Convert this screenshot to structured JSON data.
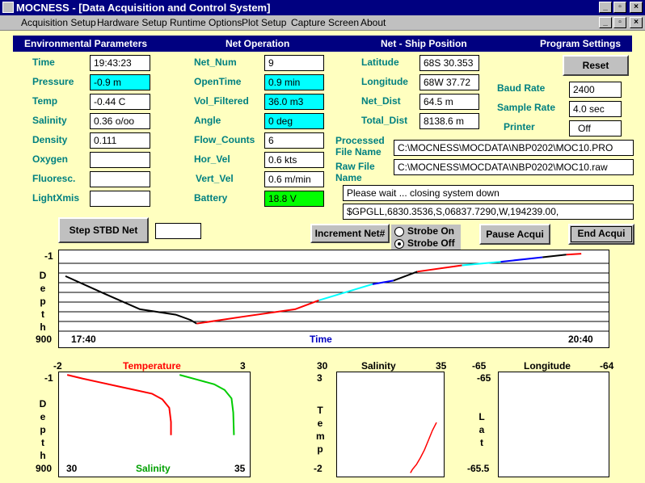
{
  "window": {
    "title": "MOCNESS - [Data Acquisition and Control System]"
  },
  "menu": [
    "Acquisition Setup",
    "Hardware Setup",
    "Runtime Options",
    "Plot Setup",
    "Capture Screen",
    "About"
  ],
  "headers": {
    "env": "Environmental Parameters",
    "net": "Net Operation",
    "pos": "Net - Ship Position",
    "prog": "Program Settings"
  },
  "env": {
    "time_label": "Time",
    "time": "19:43:23",
    "pressure_label": "Pressure",
    "pressure": "-0.9 m",
    "temp_label": "Temp",
    "temp": "-0.44 C",
    "salinity_label": "Salinity",
    "salinity": "0.36 o/oo",
    "density_label": "Density",
    "density": "0.111",
    "oxygen_label": "Oxygen",
    "oxygen": "",
    "fluoresc_label": "Fluoresc.",
    "fluoresc": "",
    "lightx_label": "LightXmis",
    "lightx": ""
  },
  "net": {
    "num_label": "Net_Num",
    "num": "9",
    "opentime_label": "OpenTime",
    "opentime": "0.9 min",
    "vol_label": "Vol_Filtered",
    "vol": "36.0 m3",
    "angle_label": "Angle",
    "angle": "0 deg",
    "flow_label": "Flow_Counts",
    "flow": "6",
    "horvel_label": "Hor_Vel",
    "horvel": "0.6 kts",
    "vertvel_label": "Vert_Vel",
    "vertvel": "0.6 m/min",
    "battery_label": "Battery",
    "battery": "18.8 V"
  },
  "pos": {
    "lat_label": "Latitude",
    "lat": "68S 30.353",
    "lon_label": "Longitude",
    "lon": "68W 37.72",
    "netdist_label": "Net_Dist",
    "netdist": "64.5 m",
    "totaldist_label": "Total_Dist",
    "totaldist": "8138.6 m"
  },
  "prog": {
    "reset": "Reset",
    "baud_label": "Baud Rate",
    "baud": "2400",
    "sample_label": "Sample Rate",
    "sample": "4.0 sec",
    "printer_label": "Printer",
    "printer": "Off"
  },
  "files": {
    "processed_label_1": "Processed",
    "processed_label_2": "File Name",
    "processed": "C:\\MOCNESS\\MOCDATA\\NBP0202\\MOC10.PRO",
    "raw_label_1": "Raw File",
    "raw_label_2": "Name",
    "raw": "C:\\MOCNESS\\MOCDATA\\NBP0202\\MOC10.raw",
    "status": "Please wait ... closing system down",
    "gps": "$GPGLL,6830.3536,S,06837.7290,W,194239.00,"
  },
  "buttons": {
    "step": "Step STBD Net",
    "step_value": "",
    "increment": "Increment Net#",
    "pause": "Pause Acqui",
    "end": "End Acqui"
  },
  "strobe": {
    "on": "Strobe On",
    "off": "Strobe Off",
    "selected": "off"
  },
  "colors": {
    "navy": "#000080",
    "label": "#008080",
    "bg": "#ffffc0"
  },
  "chart_data": [
    {
      "type": "line",
      "title": "",
      "xlabel": "Time",
      "ylabel": "Depth",
      "x_ticks": [
        "17:40",
        "20:40"
      ],
      "y_ticks": [
        "-1",
        "900"
      ],
      "xlim": [
        "17:40",
        "20:40"
      ],
      "ylim": [
        -1,
        900
      ],
      "grid": true,
      "series": [
        {
          "color": "#000000",
          "x": [
            "17:40",
            "17:52",
            "18:05",
            "18:17",
            "18:22",
            "18:24"
          ],
          "y": [
            250,
            430,
            620,
            680,
            740,
            780
          ]
        },
        {
          "color": "#ff0000",
          "x": [
            "18:24",
            "18:40",
            "18:57",
            "19:05"
          ],
          "y": [
            780,
            700,
            620,
            520
          ]
        },
        {
          "color": "#00ffff",
          "x": [
            "19:05",
            "19:15",
            "19:23"
          ],
          "y": [
            520,
            420,
            340
          ]
        },
        {
          "color": "#0000ff",
          "x": [
            "19:23",
            "19:30"
          ],
          "y": [
            340,
            300
          ]
        },
        {
          "color": "#000000",
          "x": [
            "19:30",
            "19:38"
          ],
          "y": [
            300,
            200
          ]
        },
        {
          "color": "#ff0000",
          "x": [
            "19:38",
            "19:53"
          ],
          "y": [
            200,
            130
          ]
        },
        {
          "color": "#00ffff",
          "x": [
            "19:53",
            "20:06"
          ],
          "y": [
            130,
            90
          ]
        },
        {
          "color": "#0000ff",
          "x": [
            "20:06",
            "20:20"
          ],
          "y": [
            90,
            40
          ]
        },
        {
          "color": "#000000",
          "x": [
            "20:20",
            "20:28"
          ],
          "y": [
            40,
            10
          ]
        },
        {
          "color": "#ff0000",
          "x": [
            "20:28",
            "20:33"
          ],
          "y": [
            10,
            0
          ]
        }
      ]
    },
    {
      "type": "line",
      "title": "",
      "ylabel": "Depth",
      "xlabel_top": "Temperature",
      "xlabel_bottom": "Salinity",
      "temp_ticks": [
        "-2",
        "3"
      ],
      "sal_ticks": [
        "30",
        "35"
      ],
      "y_ticks": [
        "-1",
        "900"
      ],
      "temp_lim": [
        -2,
        3
      ],
      "sal_lim": [
        30,
        35
      ],
      "ylim": [
        -1,
        900
      ],
      "series": [
        {
          "name": "Temperature",
          "color": "#ff0000",
          "x": [
            -1.95,
            -1.5,
            -1.0,
            -0.5,
            0.0,
            0.5,
            0.8,
            1.0,
            1.05,
            1.05
          ],
          "y": [
            0,
            40,
            80,
            120,
            160,
            200,
            260,
            350,
            500,
            640
          ]
        },
        {
          "name": "Salinity",
          "color": "#00cc00",
          "x": [
            33.3,
            33.8,
            34.3,
            34.6,
            34.8,
            34.85,
            34.87
          ],
          "y": [
            0,
            50,
            100,
            160,
            250,
            400,
            640
          ]
        }
      ]
    },
    {
      "type": "scatter",
      "title": "Salinity",
      "xlabel": "Salinity",
      "ylabel": "Temp",
      "x_ticks": [
        "30",
        "35"
      ],
      "y_ticks": [
        "3",
        "-2"
      ],
      "xlim": [
        30,
        35
      ],
      "ylim": [
        -2,
        3
      ],
      "series": [
        {
          "color": "#ff0000",
          "x": [
            33.5,
            33.6,
            33.8,
            34.0,
            34.2,
            34.4,
            34.6,
            34.8
          ],
          "y": [
            -1.98,
            -1.8,
            -1.55,
            -1.2,
            -0.8,
            -0.3,
            0.2,
            0.6
          ]
        }
      ]
    },
    {
      "type": "scatter",
      "title": "Longitude",
      "xlabel": "Longitude",
      "ylabel": "Lat",
      "x_ticks": [
        "-65",
        "-64"
      ],
      "y_ticks": [
        "-65",
        "-65.5"
      ],
      "xlim": [
        -65,
        -64
      ],
      "ylim": [
        -65.5,
        -65
      ],
      "series": []
    }
  ]
}
